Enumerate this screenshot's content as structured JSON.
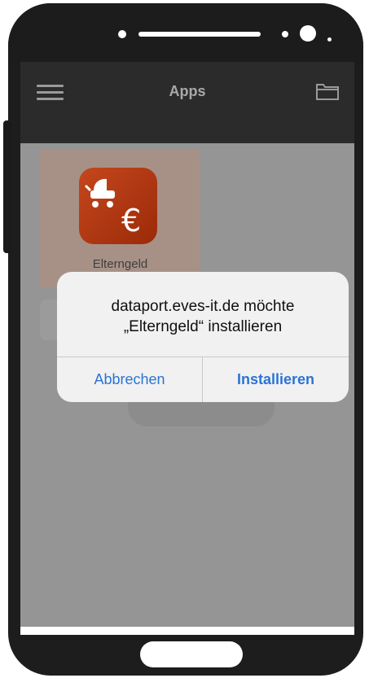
{
  "header": {
    "title": "Apps",
    "menu_icon": "hamburger-icon",
    "folder_icon": "folder-icon"
  },
  "app": {
    "label": "Elterngeld",
    "icon": "stroller-euro-icon"
  },
  "dialog": {
    "message_line1": "dataport.eves-it.de möchte",
    "message_line2": "„Elterngeld“ installieren",
    "cancel_label": "Abbrechen",
    "install_label": "Installieren"
  },
  "colors": {
    "accent": "#2b74d4",
    "app_icon": "#b83a14",
    "header": "#2b2b2b",
    "dim_overlay": "#959595"
  }
}
